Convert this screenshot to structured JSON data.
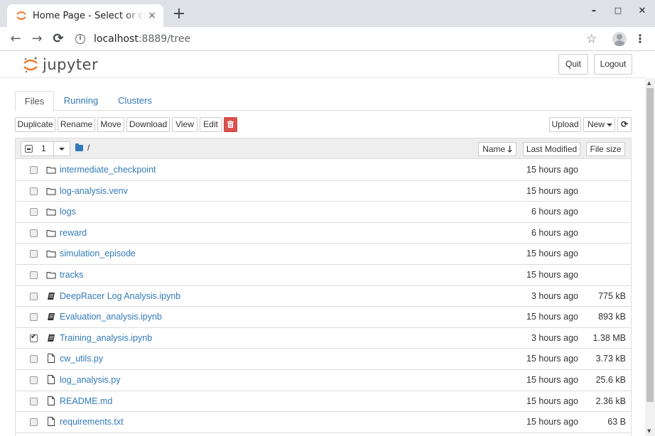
{
  "browser": {
    "tab_title": "Home Page - Select or create a notebook",
    "tab_close": "×",
    "new_tab": "+",
    "url_host": "localhost",
    "url_rest": ":8889/tree",
    "info_icon": "i",
    "win_minimize": "–",
    "win_maximize": "□",
    "win_close": "✕",
    "back": "←",
    "forward": "→",
    "reload": "⟳",
    "star": "☆",
    "menu": "⋮"
  },
  "header": {
    "logo_text": "jupyter",
    "quit_label": "Quit",
    "logout_label": "Logout"
  },
  "tabs": [
    {
      "label": "Files",
      "active": true
    },
    {
      "label": "Running",
      "active": false
    },
    {
      "label": "Clusters",
      "active": false
    }
  ],
  "toolbar": {
    "duplicate": "Duplicate",
    "rename": "Rename",
    "move": "Move",
    "download": "Download",
    "view": "View",
    "edit": "Edit",
    "delete_icon": "trash-icon",
    "upload": "Upload",
    "new": "New",
    "refresh_icon": "refresh-icon"
  },
  "list_header": {
    "selected_count": "1",
    "breadcrumb": "/",
    "name_col": "Name",
    "modified_col": "Last Modified",
    "size_col": "File size"
  },
  "files": [
    {
      "name": "intermediate_checkpoint",
      "type": "folder",
      "modified": "15 hours ago",
      "size": "",
      "checked": false
    },
    {
      "name": "log-analysis.venv",
      "type": "folder",
      "modified": "15 hours ago",
      "size": "",
      "checked": false
    },
    {
      "name": "logs",
      "type": "folder",
      "modified": "6 hours ago",
      "size": "",
      "checked": false
    },
    {
      "name": "reward",
      "type": "folder",
      "modified": "6 hours ago",
      "size": "",
      "checked": false
    },
    {
      "name": "simulation_episode",
      "type": "folder",
      "modified": "15 hours ago",
      "size": "",
      "checked": false
    },
    {
      "name": "tracks",
      "type": "folder",
      "modified": "15 hours ago",
      "size": "",
      "checked": false
    },
    {
      "name": "DeepRacer Log Analysis.ipynb",
      "type": "notebook",
      "modified": "3 hours ago",
      "size": "775 kB",
      "checked": false
    },
    {
      "name": "Evaluation_analysis.ipynb",
      "type": "notebook",
      "modified": "15 hours ago",
      "size": "893 kB",
      "checked": false
    },
    {
      "name": "Training_analysis.ipynb",
      "type": "notebook",
      "modified": "3 hours ago",
      "size": "1.38 MB",
      "checked": true
    },
    {
      "name": "cw_utils.py",
      "type": "file",
      "modified": "15 hours ago",
      "size": "3.73 kB",
      "checked": false
    },
    {
      "name": "log_analysis.py",
      "type": "file",
      "modified": "15 hours ago",
      "size": "25.6 kB",
      "checked": false
    },
    {
      "name": "README.md",
      "type": "file",
      "modified": "15 hours ago",
      "size": "2.36 kB",
      "checked": false
    },
    {
      "name": "requirements.txt",
      "type": "file",
      "modified": "15 hours ago",
      "size": "63 B",
      "checked": false
    }
  ],
  "colors": {
    "link": "#337ab7",
    "danger": "#d9534f",
    "jupyter_orange": "#f37726"
  }
}
